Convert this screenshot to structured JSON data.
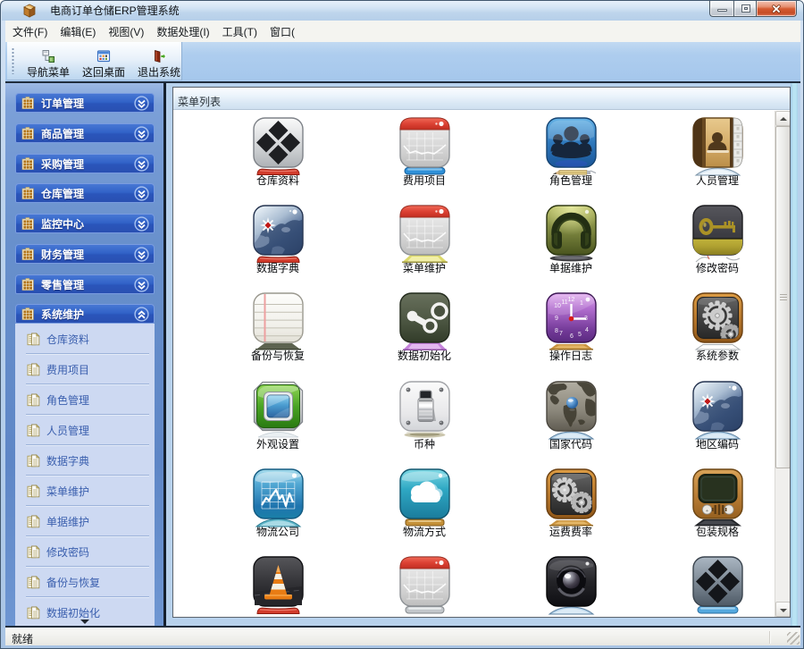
{
  "window": {
    "title": "电商订单仓储ERP管理系统",
    "icon": "app-box-icon",
    "controls": {
      "minimize": "minimize",
      "maximize": "maximize",
      "close": "close"
    }
  },
  "menu_bar": {
    "items": [
      "文件(F)",
      "编辑(E)",
      "视图(V)",
      "数据处理(I)",
      "工具(T)",
      "窗口("
    ]
  },
  "toolbar": {
    "buttons": [
      {
        "label": "导航菜单",
        "icon": "navigation-menu-icon"
      },
      {
        "label": "这回桌面",
        "icon": "return-desktop-icon"
      },
      {
        "label": "退出系统",
        "icon": "exit-system-icon"
      }
    ]
  },
  "sidebar": {
    "groups": [
      {
        "label": "订单管理",
        "icon": "grid-panel-icon",
        "state": "collapsed"
      },
      {
        "label": "商品管理",
        "icon": "grid-panel-icon",
        "state": "collapsed"
      },
      {
        "label": "采购管理",
        "icon": "grid-panel-icon",
        "state": "collapsed"
      },
      {
        "label": "仓库管理",
        "icon": "grid-panel-icon",
        "state": "collapsed"
      },
      {
        "label": "监控中心",
        "icon": "grid-panel-icon",
        "state": "collapsed"
      },
      {
        "label": "财务管理",
        "icon": "grid-panel-icon",
        "state": "collapsed"
      },
      {
        "label": "零售管理",
        "icon": "grid-panel-icon",
        "state": "collapsed"
      },
      {
        "label": "系统维护",
        "icon": "grid-panel-icon",
        "state": "expanded",
        "items": [
          "仓库资料",
          "费用项目",
          "角色管理",
          "人员管理",
          "数据字典",
          "菜单维护",
          "单据维护",
          "修改密码",
          "备份与恢复",
          "数据初始化"
        ]
      }
    ],
    "more_indicator": "scroll-down-triangle"
  },
  "main": {
    "header": "菜单列表",
    "tiles": [
      {
        "label": "仓库资料",
        "icon": "diamonds-silver",
        "base": "bar-red"
      },
      {
        "label": "费用项目",
        "icon": "calendar-chart",
        "base": "bar-blue"
      },
      {
        "label": "角色管理",
        "icon": "users-blue",
        "base": "pencil"
      },
      {
        "label": "人员管理",
        "icon": "address-book",
        "base": "glass-silver"
      },
      {
        "label": "数据字典",
        "icon": "map-navy",
        "base": "bar-red"
      },
      {
        "label": "菜单维护",
        "icon": "calendar-chart",
        "base": "bar-yellow"
      },
      {
        "label": "单据维护",
        "icon": "headphones-olive",
        "base": "shadow-dark"
      },
      {
        "label": "修改密码",
        "icon": "key-dark",
        "base": "wire"
      },
      {
        "label": "备份与恢复",
        "icon": "notepad",
        "base": "trap-olive"
      },
      {
        "label": "数据初始化",
        "icon": "steam-green",
        "base": "bar-violet"
      },
      {
        "label": "操作日志",
        "icon": "clock-purple",
        "base": "trap-gold"
      },
      {
        "label": "系统参数",
        "icon": "gears-bronze",
        "base": "trap-outline"
      },
      {
        "label": "外观设置",
        "icon": "screen-green",
        "base": "glass-faint"
      },
      {
        "label": "币种",
        "icon": "switch-plate",
        "base": "blur-khaki"
      },
      {
        "label": "国家代码",
        "icon": "worldmap-gray",
        "base": "glass-blue"
      },
      {
        "label": "地区编码",
        "icon": "map-navy",
        "base": "glass-blue"
      },
      {
        "label": "物流公司",
        "icon": "chart-blue",
        "base": "glass-teal"
      },
      {
        "label": "物流方式",
        "icon": "cloud-teal",
        "base": "bar-gold"
      },
      {
        "label": "运费费率",
        "icon": "gears-bronze2",
        "base": "trap-gold"
      },
      {
        "label": "包装规格",
        "icon": "tv-brown",
        "base": "trap-dark"
      },
      {
        "label": "",
        "icon": "cone-dark",
        "base": "bar-red"
      },
      {
        "label": "",
        "icon": "calendar-chart",
        "base": "bar-silver"
      },
      {
        "label": "",
        "icon": "camera-black",
        "base": "glass-blue"
      },
      {
        "label": "",
        "icon": "diamonds-steel",
        "base": "bar-skyblue"
      }
    ]
  },
  "status_bar": {
    "text": "就绪"
  },
  "colors": {
    "titlebar_blue": "#bed5ec",
    "accent_header_blue": "#2f5cbe",
    "sidebar_blue": "#6890cc",
    "sidebar_expanded": "#cdd9f2",
    "toolbar_blue": "#a9c9ec",
    "close_button_red": "#d55b32",
    "panel_white": "#ffffff"
  }
}
